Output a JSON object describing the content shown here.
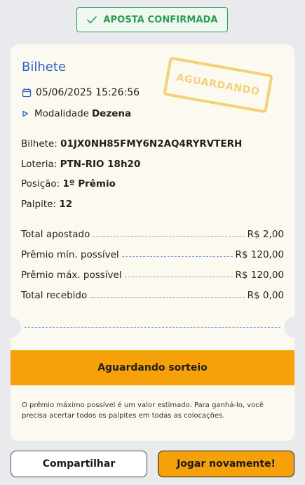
{
  "badge": {
    "label": "APOSTA CONFIRMADA"
  },
  "ticket": {
    "title": "Bilhete",
    "stamp": "AGUARDANDO",
    "datetime": "05/06/2025 15:26:56",
    "modality_label": "Modalidade",
    "modality_value": "Dezena",
    "details": {
      "bilhete_label": "Bilhete:",
      "bilhete_value": "01JX0NH85FMY6N2AQ4RYRVTERH",
      "loteria_label": "Loteria:",
      "loteria_value": "PTN-RIO 18h20",
      "posicao_label": "Posição:",
      "posicao_value": "1º Prêmio",
      "palpite_label": "Palpite:",
      "palpite_value": "12"
    },
    "summary": [
      {
        "label": "Total apostado",
        "value": "R$ 2,00"
      },
      {
        "label": "Prêmio mín. possível",
        "value": "R$ 120,00"
      },
      {
        "label": "Prêmio máx. possível",
        "value": "R$ 120,00"
      },
      {
        "label": "Total recebido",
        "value": "R$ 0,00"
      }
    ],
    "status": "Aguardando sorteio",
    "footnote": "O prêmio máximo possível é um valor estimado. Para ganhá-lo, você precisa acertar todos os palpites em todas as colocações."
  },
  "actions": {
    "share": "Compartilhar",
    "play_again": "Jogar novamente!"
  },
  "colors": {
    "accent_blue": "#2f62c9",
    "success_green": "#2e9b53",
    "warning_orange": "#f6a10a",
    "stamp_yellow": "#f2cf71"
  }
}
